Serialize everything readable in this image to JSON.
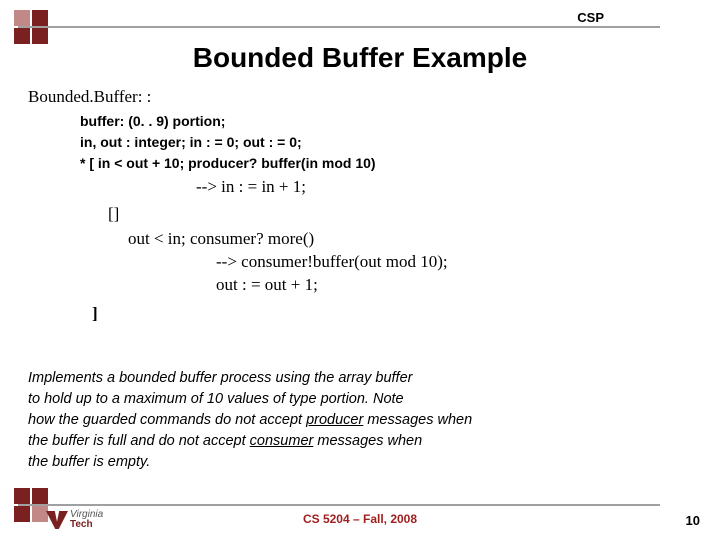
{
  "header": {
    "label": "CSP"
  },
  "title": "Bounded Buffer Example",
  "code": {
    "decl": "Bounded.Buffer: :",
    "def1": "buffer: (0. . 9) portion;",
    "def2": "in, out : integer; in : = 0; out : = 0;",
    "def3": "* [ in < out + 10; producer? buffer(in mod 10)",
    "arrow1": "--> in : = in + 1;",
    "sep": "[]",
    "guard2": "out < in; consumer? more()",
    "arrow2": "--> consumer!buffer(out mod 10);",
    "arrow3": "out : = out + 1;",
    "close": "]"
  },
  "description": {
    "l1": "Implements a bounded buffer process using the array buffer",
    "l2": "to hold up to a maximum of 10 values of type portion. Note",
    "l3a": "how the guarded commands do not accept ",
    "l3u": "producer",
    "l3b": " messages when",
    "l4a": "the buffer is full and do not accept ",
    "l4u": "consumer",
    "l4b": " messages when",
    "l5": "the buffer is empty."
  },
  "footer": {
    "course": "CS 5204 – Fall, 2008",
    "page": "10"
  },
  "logo": {
    "l1": "Virginia",
    "l2": "Tech"
  }
}
